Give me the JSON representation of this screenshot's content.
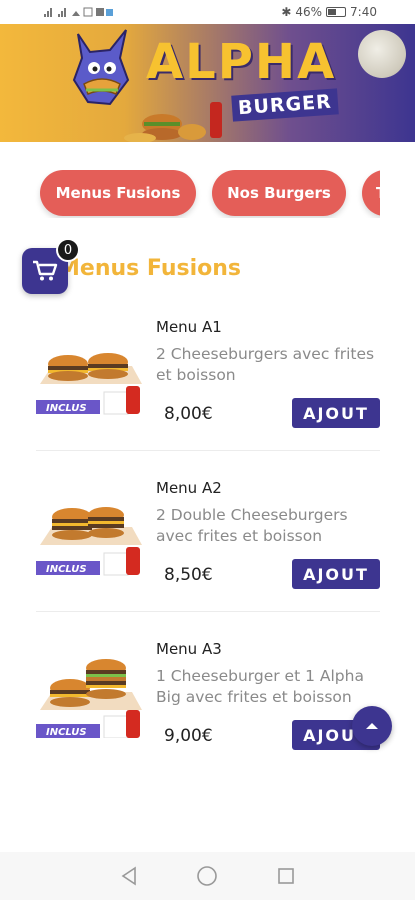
{
  "status": {
    "left_icons": "signal wifi notifications",
    "battery_percent": "46%",
    "time": "7:40"
  },
  "banner": {
    "brand_main": "ALPHA",
    "brand_sub": "BURGER"
  },
  "categories": [
    {
      "label": "Menus Fusions"
    },
    {
      "label": "Nos Burgers"
    },
    {
      "label": "T"
    }
  ],
  "section": {
    "title": "Menus Fusions"
  },
  "cart": {
    "count": "0"
  },
  "menus": [
    {
      "name": "Menu A1",
      "description": "2 Cheeseburgers avec frites et boisson",
      "price": "8,00€",
      "button": "AJOUT",
      "tag": "INCLUS"
    },
    {
      "name": "Menu A2",
      "description": "2 Double Cheeseburgers avec frites et boisson",
      "price": "8,50€",
      "button": "AJOUT",
      "tag": "INCLUS"
    },
    {
      "name": "Menu A3",
      "description": "1 Cheeseburger et 1 Alpha Big avec frites et boisson",
      "price": "9,00€",
      "button": "AJOUT",
      "tag": "INCLUS"
    }
  ],
  "colors": {
    "accent_red": "#e45e58",
    "accent_purple": "#3d3590",
    "accent_yellow": "#f2b53a"
  },
  "icons": {
    "cart": "cart-icon",
    "scroll_top": "chevron-up-icon",
    "back": "back-triangle-icon",
    "home": "home-circle-icon",
    "recents": "recents-square-icon"
  }
}
